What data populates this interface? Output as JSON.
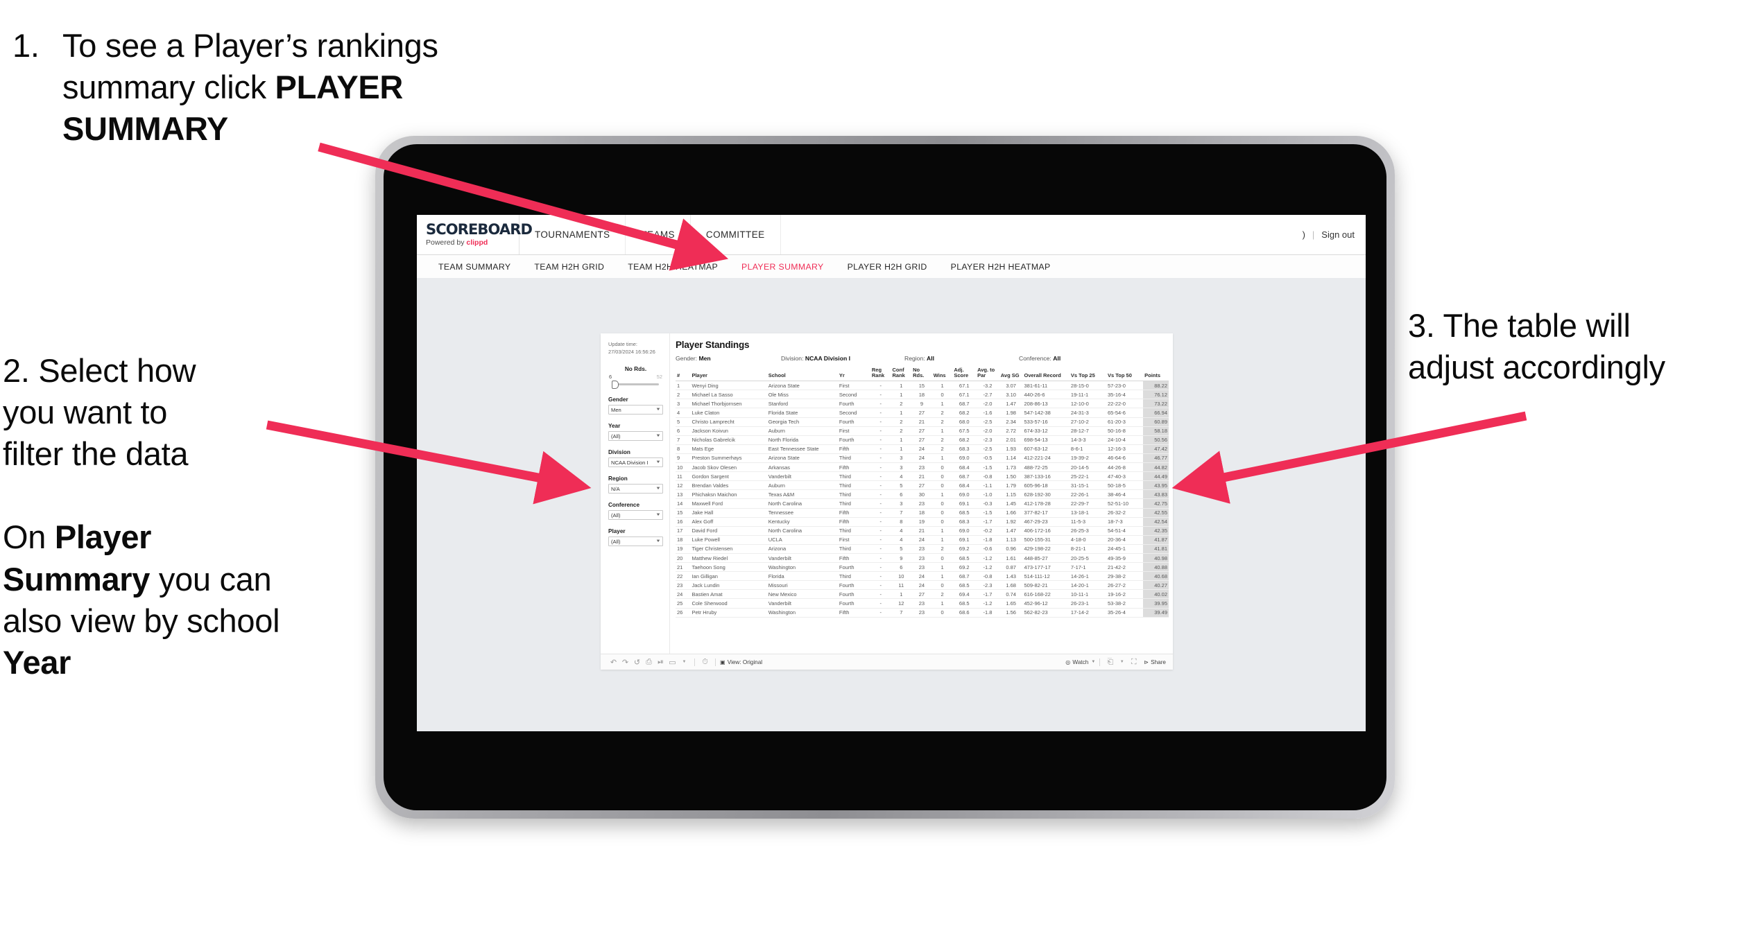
{
  "annotations": {
    "step1": {
      "number": "1.",
      "text_before": "To see a Player’s rankings summary click ",
      "bold": "PLAYER SUMMARY"
    },
    "step2": {
      "line1": "2. Select how",
      "line2": "you want to",
      "line3": "filter the data",
      "p2_a": "On ",
      "p2_b1": "Player Summary",
      "p2_c": " you can also view by school ",
      "p2_b2": "Year"
    },
    "step3": {
      "line1": "3. The table will",
      "line2": "adjust accordingly"
    },
    "arrow_color": "#ef2d56"
  },
  "app": {
    "brand": {
      "name": "SCOREBOARD",
      "powered_prefix": "Powered by ",
      "powered_brand": "clippd"
    },
    "top_nav": [
      {
        "label": "TOURNAMENTS"
      },
      {
        "label": "TEAMS"
      },
      {
        "label": "COMMITTEE"
      }
    ],
    "header_right": {
      "partial": ")",
      "separator": "|",
      "sign_out": "Sign out"
    },
    "sub_nav": [
      {
        "label": "TEAM SUMMARY",
        "active": false
      },
      {
        "label": "TEAM H2H GRID",
        "active": false
      },
      {
        "label": "TEAM H2H HEATMAP",
        "active": false
      },
      {
        "label": "PLAYER SUMMARY",
        "active": true
      },
      {
        "label": "PLAYER H2H GRID",
        "active": false
      },
      {
        "label": "PLAYER H2H HEATMAP",
        "active": false
      }
    ],
    "accent_color": "#ef2d56"
  },
  "viz": {
    "update_time_label": "Update time:",
    "update_time_value": "27/03/2024 16:56:26",
    "title": "Player Standings",
    "subheader": [
      {
        "label": "Gender:",
        "value": "Men"
      },
      {
        "label": "Division:",
        "value": "NCAA Division I"
      },
      {
        "label": "Region:",
        "value": "All"
      },
      {
        "label": "Conference:",
        "value": "All"
      }
    ],
    "slider": {
      "title": "No Rds.",
      "min": "6",
      "max": "52"
    },
    "filters": [
      {
        "label": "Gender",
        "value": "Men"
      },
      {
        "label": "Year",
        "value": "(All)"
      },
      {
        "label": "Division",
        "value": "NCAA Division I"
      },
      {
        "label": "Region",
        "value": "N/A"
      },
      {
        "label": "Conference",
        "value": "(All)"
      },
      {
        "label": "Player",
        "value": "(All)"
      }
    ],
    "toolbar": {
      "view_label": "View: Original",
      "watch_label": "Watch",
      "share_label": "Share"
    }
  },
  "table": {
    "columns": [
      "#",
      "Player",
      "School",
      "Yr",
      "Reg Rank",
      "Conf Rank",
      "No Rds.",
      "Wins",
      "Adj. Score",
      "Avg. to Par",
      "Avg SG",
      "Overall Record",
      "Vs Top 25",
      "Vs Top 50",
      "Points"
    ],
    "rows": [
      [
        "1",
        "Wenyi Ding",
        "Arizona State",
        "First",
        "-",
        "1",
        "15",
        "1",
        "67.1",
        "-3.2",
        "3.07",
        "381-61-11",
        "28-15-0",
        "57-23-0",
        "88.22"
      ],
      [
        "2",
        "Michael La Sasso",
        "Ole Miss",
        "Second",
        "-",
        "1",
        "18",
        "0",
        "67.1",
        "-2.7",
        "3.10",
        "440-26-6",
        "19-11-1",
        "35-16-4",
        "76.12"
      ],
      [
        "3",
        "Michael Thorbjornsen",
        "Stanford",
        "Fourth",
        "-",
        "2",
        "9",
        "1",
        "68.7",
        "-2.0",
        "1.47",
        "208-86-13",
        "12-10-0",
        "22-22-0",
        "73.22"
      ],
      [
        "4",
        "Luke Claton",
        "Florida State",
        "Second",
        "-",
        "1",
        "27",
        "2",
        "68.2",
        "-1.6",
        "1.98",
        "547-142-38",
        "24-31-3",
        "65-54-6",
        "66.94"
      ],
      [
        "5",
        "Christo Lamprecht",
        "Georgia Tech",
        "Fourth",
        "-",
        "2",
        "21",
        "2",
        "68.0",
        "-2.5",
        "2.34",
        "533-57-16",
        "27-10-2",
        "61-20-3",
        "60.89"
      ],
      [
        "6",
        "Jackson Koivun",
        "Auburn",
        "First",
        "-",
        "2",
        "27",
        "1",
        "67.5",
        "-2.0",
        "2.72",
        "674-33-12",
        "28-12-7",
        "50-16-8",
        "58.18"
      ],
      [
        "7",
        "Nicholas Gabrelcik",
        "North Florida",
        "Fourth",
        "-",
        "1",
        "27",
        "2",
        "68.2",
        "-2.3",
        "2.01",
        "698-54-13",
        "14-3-3",
        "24-10-4",
        "50.56"
      ],
      [
        "8",
        "Mats Ege",
        "East Tennessee State",
        "Fifth",
        "-",
        "1",
        "24",
        "2",
        "68.3",
        "-2.5",
        "1.93",
        "607-63-12",
        "8-6-1",
        "12-16-3",
        "47.42"
      ],
      [
        "9",
        "Preston Summerhays",
        "Arizona State",
        "Third",
        "-",
        "3",
        "24",
        "1",
        "69.0",
        "-0.5",
        "1.14",
        "412-221-24",
        "19-39-2",
        "46-64-6",
        "46.77"
      ],
      [
        "10",
        "Jacob Skov Olesen",
        "Arkansas",
        "Fifth",
        "-",
        "3",
        "23",
        "0",
        "68.4",
        "-1.5",
        "1.73",
        "488-72-25",
        "20-14-5",
        "44-26-8",
        "44.82"
      ],
      [
        "11",
        "Gordon Sargent",
        "Vanderbilt",
        "Third",
        "-",
        "4",
        "21",
        "0",
        "68.7",
        "-0.8",
        "1.50",
        "387-133-16",
        "25-22-1",
        "47-40-3",
        "44.49"
      ],
      [
        "12",
        "Brendan Valdes",
        "Auburn",
        "Third",
        "-",
        "5",
        "27",
        "0",
        "68.4",
        "-1.1",
        "1.79",
        "605-96-18",
        "31-15-1",
        "50-18-5",
        "43.95"
      ],
      [
        "13",
        "Phichaksn Maichon",
        "Texas A&M",
        "Third",
        "-",
        "6",
        "30",
        "1",
        "69.0",
        "-1.0",
        "1.15",
        "628-192-30",
        "22-26-1",
        "38-46-4",
        "43.83"
      ],
      [
        "14",
        "Maxwell Ford",
        "North Carolina",
        "Third",
        "-",
        "3",
        "23",
        "0",
        "69.1",
        "-0.3",
        "1.45",
        "412-178-28",
        "22-29-7",
        "52-51-10",
        "42.75"
      ],
      [
        "15",
        "Jake Hall",
        "Tennessee",
        "Fifth",
        "-",
        "7",
        "18",
        "0",
        "68.5",
        "-1.5",
        "1.66",
        "377-82-17",
        "13-18-1",
        "26-32-2",
        "42.55"
      ],
      [
        "16",
        "Alex Goff",
        "Kentucky",
        "Fifth",
        "-",
        "8",
        "19",
        "0",
        "68.3",
        "-1.7",
        "1.92",
        "467-29-23",
        "11-5-3",
        "18-7-3",
        "42.54"
      ],
      [
        "17",
        "David Ford",
        "North Carolina",
        "Third",
        "-",
        "4",
        "21",
        "1",
        "69.0",
        "-0.2",
        "1.47",
        "406-172-16",
        "26-25-3",
        "54-51-4",
        "42.35"
      ],
      [
        "18",
        "Luke Powell",
        "UCLA",
        "First",
        "-",
        "4",
        "24",
        "1",
        "69.1",
        "-1.8",
        "1.13",
        "500-155-31",
        "4-18-0",
        "20-36-4",
        "41.87"
      ],
      [
        "19",
        "Tiger Christensen",
        "Arizona",
        "Third",
        "-",
        "5",
        "23",
        "2",
        "69.2",
        "-0.6",
        "0.96",
        "429-198-22",
        "8-21-1",
        "24-45-1",
        "41.81"
      ],
      [
        "20",
        "Matthew Riedel",
        "Vanderbilt",
        "Fifth",
        "-",
        "9",
        "23",
        "0",
        "68.5",
        "-1.2",
        "1.61",
        "448-85-27",
        "20-25-5",
        "49-35-9",
        "40.98"
      ],
      [
        "21",
        "Taehoon Song",
        "Washington",
        "Fourth",
        "-",
        "6",
        "23",
        "1",
        "69.2",
        "-1.2",
        "0.87",
        "473-177-17",
        "7-17-1",
        "21-42-2",
        "40.88"
      ],
      [
        "22",
        "Ian Gilligan",
        "Florida",
        "Third",
        "-",
        "10",
        "24",
        "1",
        "68.7",
        "-0.8",
        "1.43",
        "514-111-12",
        "14-26-1",
        "29-38-2",
        "40.68"
      ],
      [
        "23",
        "Jack Lundin",
        "Missouri",
        "Fourth",
        "-",
        "11",
        "24",
        "0",
        "68.5",
        "-2.3",
        "1.68",
        "509-82-21",
        "14-20-1",
        "26-27-2",
        "40.27"
      ],
      [
        "24",
        "Bastien Amat",
        "New Mexico",
        "Fourth",
        "-",
        "1",
        "27",
        "2",
        "69.4",
        "-1.7",
        "0.74",
        "616-168-22",
        "10-11-1",
        "19-16-2",
        "40.02"
      ],
      [
        "25",
        "Cole Sherwood",
        "Vanderbilt",
        "Fourth",
        "-",
        "12",
        "23",
        "1",
        "68.5",
        "-1.2",
        "1.65",
        "452-96-12",
        "26-23-1",
        "53-38-2",
        "39.95"
      ],
      [
        "26",
        "Petr Hruby",
        "Washington",
        "Fifth",
        "-",
        "7",
        "23",
        "0",
        "68.6",
        "-1.8",
        "1.56",
        "562-82-23",
        "17-14-2",
        "35-26-4",
        "39.49"
      ]
    ]
  }
}
